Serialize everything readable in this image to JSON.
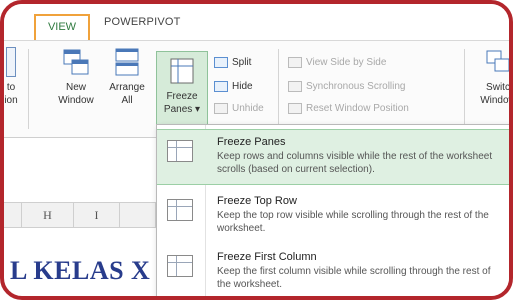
{
  "tabs": {
    "view": "VIEW",
    "powerpivot": "POWERPIVOT"
  },
  "ribbon": {
    "left_cut": [
      "to",
      "ion"
    ],
    "new_window": [
      "New",
      "Window"
    ],
    "arrange_all": [
      "Arrange",
      "All"
    ],
    "freeze_panes": [
      "Freeze",
      "Panes ▾"
    ],
    "split": "Split",
    "hide": "Hide",
    "unhide": "Unhide",
    "view_side": "View Side by Side",
    "sync_scroll": "Synchronous Scrolling",
    "reset_pos": "Reset Window Position",
    "switch_windows": [
      "Switc",
      "Window"
    ]
  },
  "columns": [
    "H",
    "I"
  ],
  "sheet_text": "L KELAS X",
  "menu": {
    "items": [
      {
        "title": "Freeze Panes",
        "desc": "Keep rows and columns visible while the rest of the worksheet scrolls (based on current selection)."
      },
      {
        "title": "Freeze Top Row",
        "desc": "Keep the top row visible while scrolling through the rest of the worksheet."
      },
      {
        "title": "Freeze First Column",
        "desc": "Keep the first column visible while scrolling through the rest of the worksheet."
      }
    ]
  },
  "colors": {
    "frame": "#b3262c",
    "view_tab_border": "#f0a23b",
    "highlight": "#dff0e2",
    "sheet_text": "#283c8c"
  }
}
